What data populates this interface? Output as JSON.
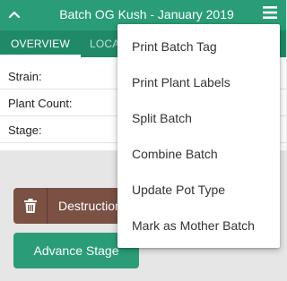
{
  "header": {
    "title": "Batch OG Kush - January 2019",
    "back_icon": "chevron-up-icon",
    "menu_icon": "hamburger-menu-icon",
    "color": "#2a9d78"
  },
  "tabs": [
    {
      "label": "OVERVIEW",
      "active": true
    },
    {
      "label": "LOCA",
      "active": false
    }
  ],
  "info": {
    "strain_label": "Strain:",
    "plant_count_label": "Plant Count:",
    "stage_label": "Stage:"
  },
  "actions": {
    "destruction_label": "Destruction",
    "destruction_icon": "trash-icon",
    "destruction_color": "#7a5143",
    "advance_label": "Advance Stage",
    "advance_color": "#2a9d78"
  },
  "menu": {
    "items": [
      {
        "label": "Print Batch Tag"
      },
      {
        "label": "Print Plant Labels"
      },
      {
        "label": "Split Batch"
      },
      {
        "label": "Combine Batch"
      },
      {
        "label": "Update Pot Type"
      },
      {
        "label": "Mark as Mother Batch"
      }
    ]
  }
}
